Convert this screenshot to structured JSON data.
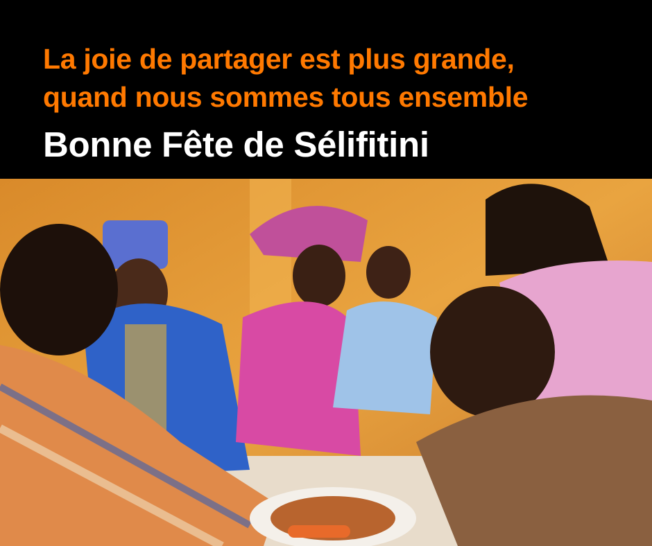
{
  "header": {
    "tagline_line1": "La joie de partager est plus grande,",
    "tagline_line2": "quand nous sommes tous ensemble",
    "title": "Bonne Fête de Sélifitini"
  },
  "colors": {
    "background": "#000000",
    "accent": "#ff7900",
    "title": "#ffffff"
  }
}
